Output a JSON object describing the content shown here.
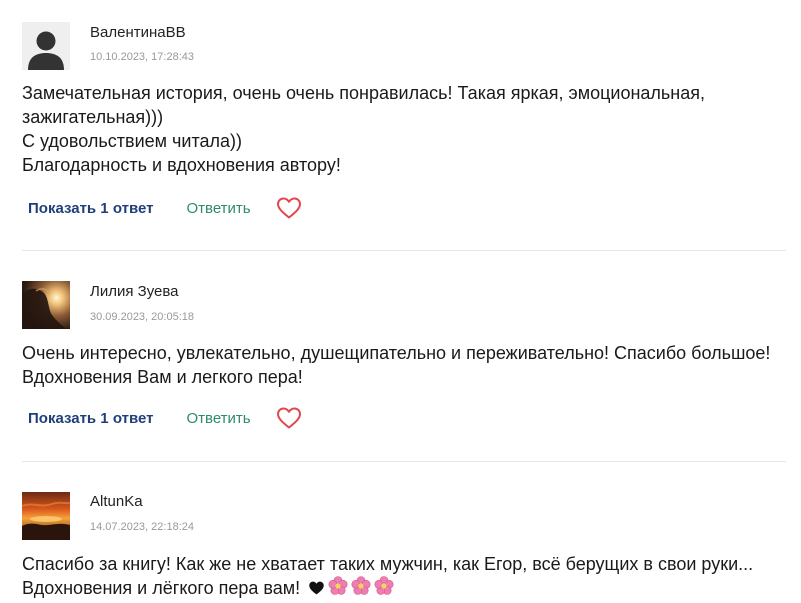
{
  "comments": [
    {
      "author": "ВалентинаВВ",
      "date": "10.10.2023, 17:28:43",
      "lines": [
        "Замечательная история, очень очень понравилась! Такая яркая, эмоциональная,",
        "зажигательная)))",
        "С удовольствием читала))",
        "Благодарность и вдохновения автору!"
      ],
      "show_replies_label": "Показать 1 ответ",
      "reply_label": "Ответить",
      "avatar_icon": "default-user-avatar"
    },
    {
      "author": "Лилия Зуева",
      "date": "30.09.2023, 20:05:18",
      "lines": [
        "Очень интересно, увлекательно, душещипательно и переживательно! Спасибо большое!",
        "Вдохновения Вам и легкого пера!"
      ],
      "show_replies_label": "Показать 1 ответ",
      "reply_label": "Ответить",
      "avatar_icon": "photo-avatar-sunset-portrait"
    },
    {
      "author": "AltunKa",
      "date": "14.07.2023, 22:18:24",
      "lines": [
        "Спасибо за книгу! Как же не хватает таких мужчин, как Егор, всё берущих в свои руки...",
        "Вдохновения и лёгкого пера вам!"
      ],
      "emojis": [
        "black-heart-icon",
        "cherry-blossom-icon",
        "cherry-blossom-icon",
        "cherry-blossom-icon"
      ],
      "avatar_icon": "photo-avatar-sunset-landscape"
    }
  ],
  "colors": {
    "show_replies": "#1f3f7a",
    "reply": "#2f8a6b",
    "like_heart": "#e0474c",
    "date": "#999999",
    "divider": "#e6e6e6"
  }
}
